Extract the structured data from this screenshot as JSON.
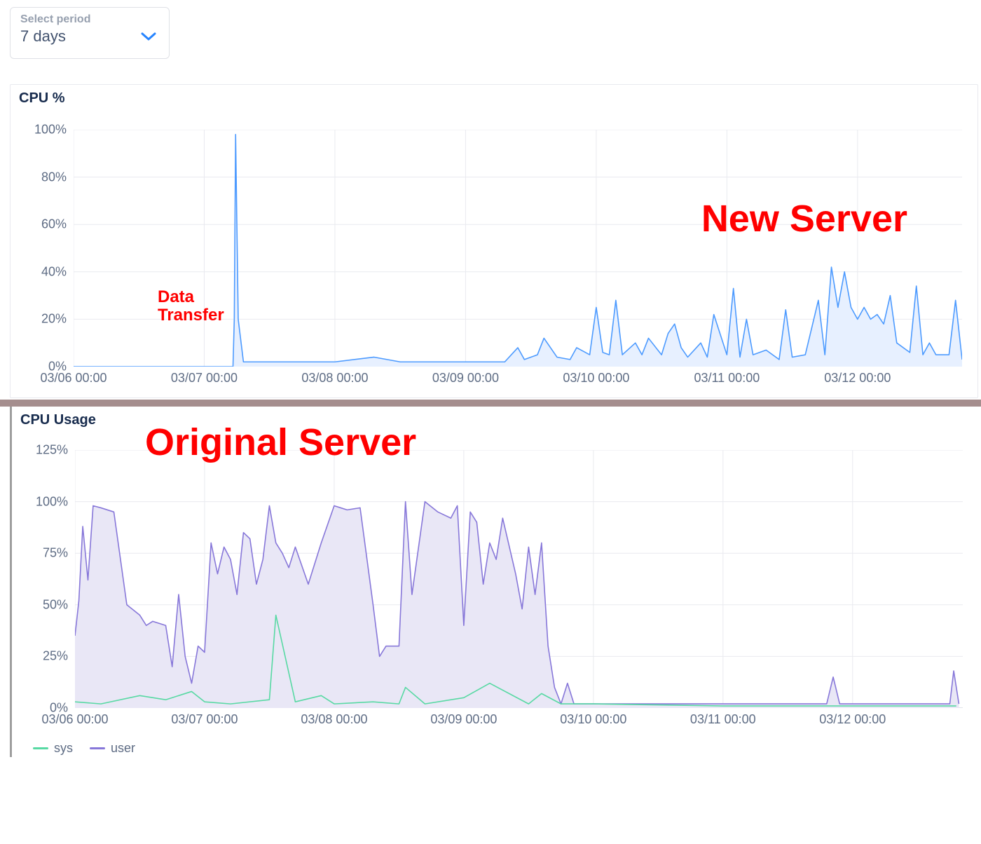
{
  "period_selector": {
    "label": "Select period",
    "value": "7 days"
  },
  "colors": {
    "blue_line": "#4c9aff",
    "blue_fill": "#e7f0ff",
    "purple_line": "#8777d9",
    "purple_fill": "#e9e7f6",
    "teal_line": "#57d9a3",
    "grid": "#e9eaef",
    "annotation": "#ff0000"
  },
  "annotations": {
    "new_server": "New Server",
    "original_server": "Original Server",
    "data_transfer": "Data\nTransfer"
  },
  "charts": {
    "top": {
      "title": "CPU %",
      "y_ticks": [
        "0%",
        "20%",
        "40%",
        "60%",
        "80%",
        "100%"
      ],
      "x_ticks": [
        "03/06 00:00",
        "03/07 00:00",
        "03/08 00:00",
        "03/09 00:00",
        "03/10 00:00",
        "03/11 00:00",
        "03/12 00:00"
      ]
    },
    "bottom": {
      "title": "CPU Usage",
      "y_ticks": [
        "0%",
        "25%",
        "50%",
        "75%",
        "100%",
        "125%"
      ],
      "x_ticks": [
        "03/06 00:00",
        "03/07 00:00",
        "03/08 00:00",
        "03/09 00:00",
        "03/10 00:00",
        "03/11 00:00",
        "03/12 00:00"
      ],
      "legend": [
        {
          "name": "sys",
          "color": "#57d9a3"
        },
        {
          "name": "user",
          "color": "#8777d9"
        }
      ]
    }
  },
  "chart_data": [
    {
      "type": "area",
      "title": "CPU %",
      "xlabel": "",
      "ylabel": "CPU %",
      "ylim": [
        0,
        100
      ],
      "x_ticks": [
        "03/06 00:00",
        "03/07 00:00",
        "03/08 00:00",
        "03/09 00:00",
        "03/10 00:00",
        "03/11 00:00",
        "03/12 00:00"
      ],
      "annotations": [
        {
          "text": "Data Transfer",
          "x": 1.25,
          "y": 15
        },
        {
          "text": "New Server",
          "x": 5.0,
          "y": 75
        }
      ],
      "series": [
        {
          "name": "cpu",
          "color": "#4c9aff",
          "x": [
            0,
            0.5,
            1.0,
            1.22,
            1.23,
            1.24,
            1.26,
            1.3,
            1.5,
            1.8,
            2.0,
            2.3,
            2.5,
            2.7,
            3.0,
            3.3,
            3.4,
            3.45,
            3.55,
            3.6,
            3.7,
            3.8,
            3.85,
            3.95,
            4.0,
            4.05,
            4.1,
            4.15,
            4.2,
            4.3,
            4.35,
            4.4,
            4.5,
            4.55,
            4.6,
            4.65,
            4.7,
            4.8,
            4.85,
            4.9,
            5.0,
            5.05,
            5.1,
            5.15,
            5.2,
            5.3,
            5.4,
            5.45,
            5.5,
            5.6,
            5.7,
            5.75,
            5.8,
            5.85,
            5.9,
            5.95,
            6.0,
            6.05,
            6.1,
            6.15,
            6.2,
            6.25,
            6.3,
            6.4,
            6.45,
            6.5,
            6.55,
            6.6,
            6.7,
            6.75,
            6.8
          ],
          "values": [
            0,
            0,
            0,
            0,
            20,
            98,
            20,
            2,
            2,
            2,
            2,
            4,
            2,
            2,
            2,
            2,
            8,
            3,
            5,
            12,
            4,
            3,
            8,
            5,
            25,
            6,
            5,
            28,
            5,
            10,
            5,
            12,
            5,
            14,
            18,
            8,
            4,
            10,
            4,
            22,
            5,
            33,
            4,
            20,
            5,
            7,
            3,
            24,
            4,
            5,
            28,
            5,
            42,
            25,
            40,
            25,
            20,
            25,
            20,
            22,
            18,
            30,
            10,
            6,
            34,
            5,
            10,
            5,
            5,
            28,
            3
          ]
        }
      ]
    },
    {
      "type": "area",
      "title": "CPU Usage",
      "xlabel": "",
      "ylabel": "CPU %",
      "ylim": [
        0,
        125
      ],
      "x_ticks": [
        "03/06 00:00",
        "03/07 00:00",
        "03/08 00:00",
        "03/09 00:00",
        "03/10 00:00",
        "03/11 00:00",
        "03/12 00:00"
      ],
      "annotations": [
        {
          "text": "Original Server",
          "x": 2.0,
          "y": 115
        }
      ],
      "legend": [
        "sys",
        "user"
      ],
      "series": [
        {
          "name": "user",
          "color": "#8777d9",
          "x": [
            0,
            0.03,
            0.06,
            0.1,
            0.14,
            0.2,
            0.3,
            0.4,
            0.5,
            0.55,
            0.6,
            0.7,
            0.75,
            0.8,
            0.85,
            0.9,
            0.95,
            1.0,
            1.05,
            1.1,
            1.15,
            1.2,
            1.25,
            1.3,
            1.35,
            1.4,
            1.45,
            1.5,
            1.55,
            1.6,
            1.65,
            1.7,
            1.8,
            1.9,
            2.0,
            2.05,
            2.1,
            2.2,
            2.3,
            2.35,
            2.4,
            2.5,
            2.55,
            2.6,
            2.7,
            2.8,
            2.9,
            2.95,
            3.0,
            3.05,
            3.1,
            3.15,
            3.2,
            3.25,
            3.3,
            3.4,
            3.45,
            3.5,
            3.55,
            3.6,
            3.65,
            3.7,
            3.75,
            3.8,
            3.85,
            4.0,
            4.5,
            5.0,
            5.5,
            5.8,
            5.85,
            5.9,
            6.5,
            6.75,
            6.78,
            6.82
          ],
          "values": [
            35,
            52,
            88,
            62,
            98,
            97,
            95,
            50,
            45,
            40,
            42,
            40,
            20,
            55,
            25,
            12,
            30,
            27,
            80,
            65,
            78,
            72,
            55,
            85,
            82,
            60,
            72,
            98,
            80,
            75,
            68,
            78,
            60,
            80,
            98,
            97,
            96,
            97,
            50,
            25,
            30,
            30,
            100,
            55,
            100,
            95,
            92,
            98,
            40,
            95,
            90,
            60,
            80,
            72,
            92,
            65,
            48,
            78,
            55,
            80,
            30,
            10,
            2,
            12,
            2,
            2,
            2,
            2,
            2,
            2,
            15,
            2,
            2,
            2,
            18,
            2
          ]
        },
        {
          "name": "sys",
          "color": "#57d9a3",
          "x": [
            0,
            0.2,
            0.5,
            0.7,
            0.9,
            1.0,
            1.2,
            1.5,
            1.55,
            1.7,
            1.9,
            2.0,
            2.3,
            2.5,
            2.55,
            2.7,
            3.0,
            3.2,
            3.5,
            3.6,
            3.75,
            4.0,
            5.0,
            6.0,
            6.8
          ],
          "values": [
            3,
            2,
            6,
            4,
            8,
            3,
            2,
            4,
            45,
            3,
            6,
            2,
            3,
            2,
            10,
            2,
            5,
            12,
            2,
            7,
            2,
            2,
            1,
            1,
            1
          ]
        }
      ]
    }
  ]
}
